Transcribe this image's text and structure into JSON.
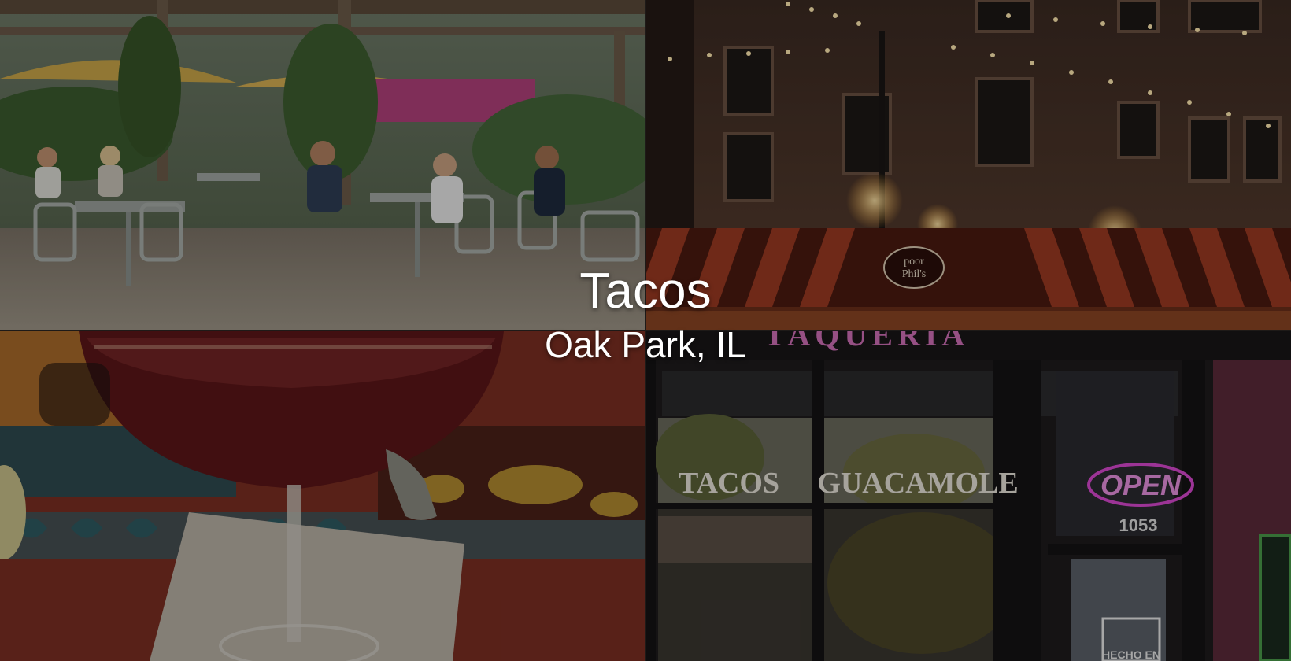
{
  "hero": {
    "title": "Tacos",
    "subtitle": "Oak Park, IL"
  },
  "photos": {
    "top_right": {
      "awning_logo_line1": "poor",
      "awning_logo_line2": "Phil's"
    },
    "bottom_right": {
      "sign_top": "TAQUERIA",
      "window_left": "TACOS",
      "window_right": "GUACAMOLE",
      "open_sign": "OPEN",
      "door_number": "1053",
      "door_decal": "HECHO EN"
    }
  },
  "colors": {
    "overlay_text": "#ffffff",
    "open_sign": "#d848d0",
    "taqueria_pink": "#d070b8",
    "awning_stripe": "#7a2a18"
  }
}
